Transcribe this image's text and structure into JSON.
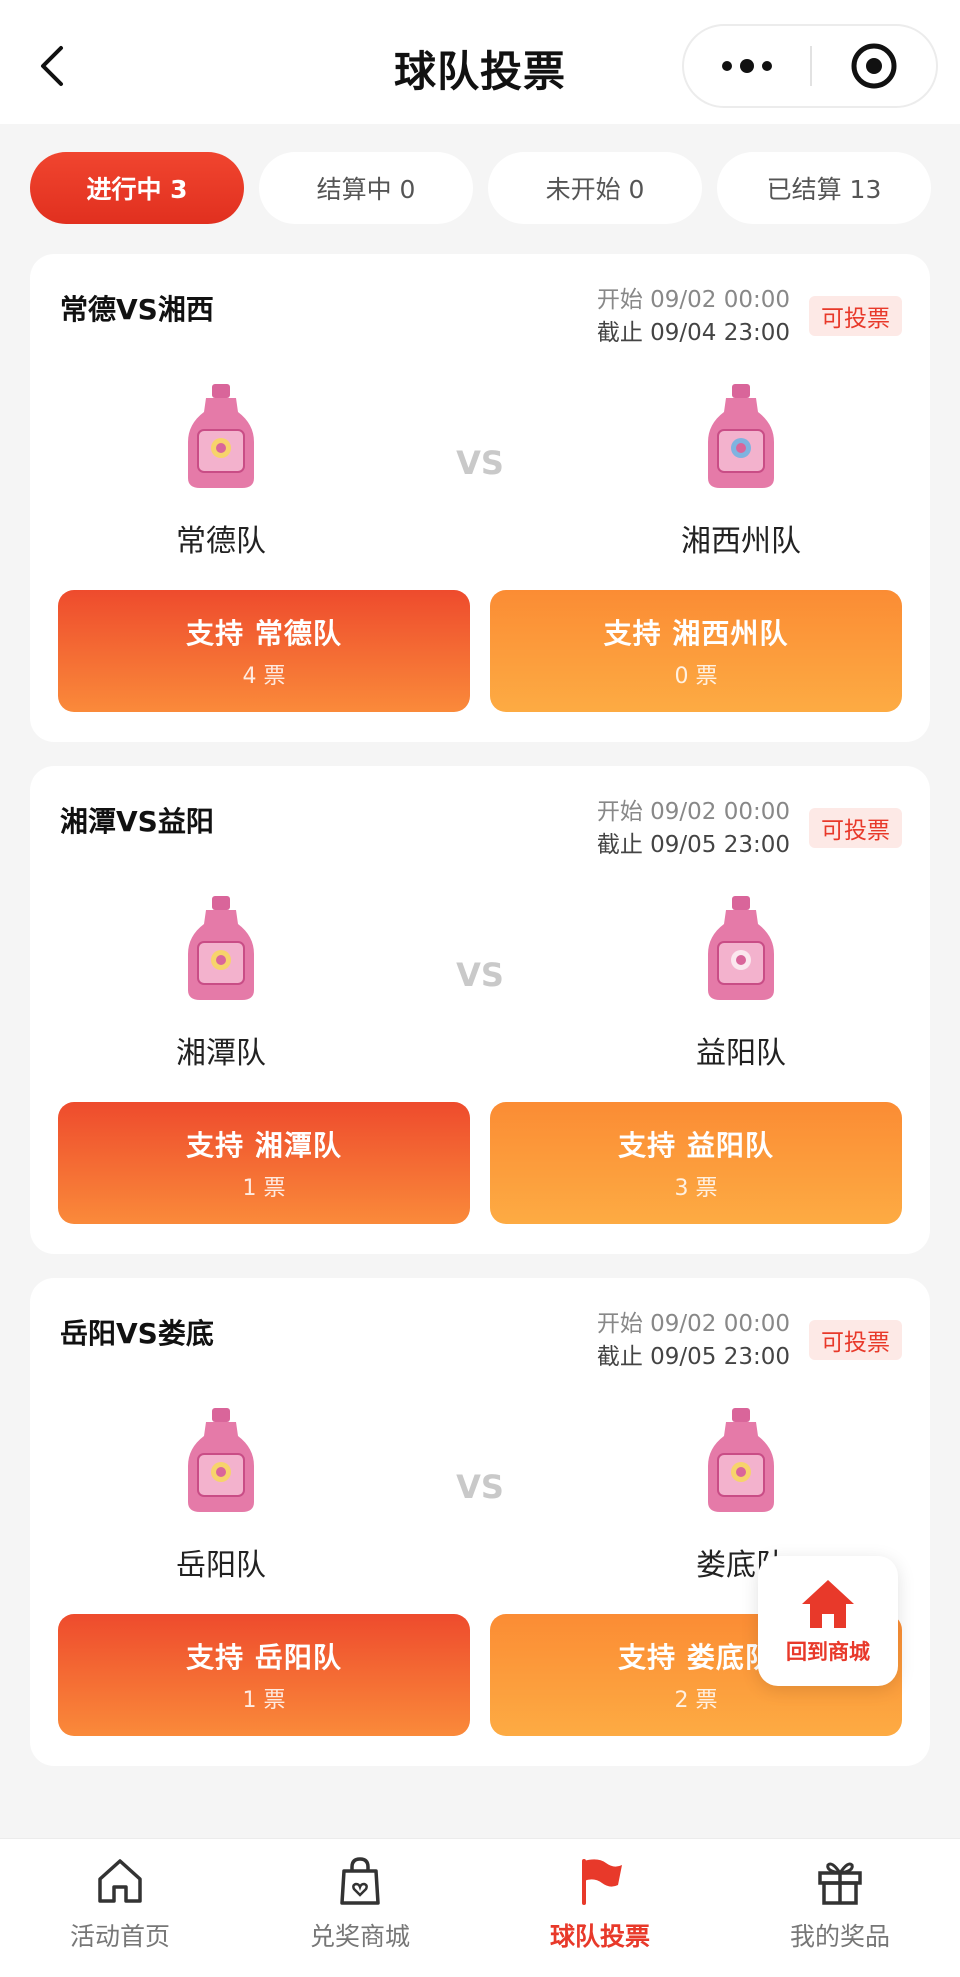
{
  "header": {
    "title": "球队投票"
  },
  "tabs": [
    {
      "label": "进行中 3"
    },
    {
      "label": "结算中 0"
    },
    {
      "label": "未开始 0"
    },
    {
      "label": "已结算 13"
    }
  ],
  "matches": [
    {
      "title": "常德VS湘西",
      "start": "开始 09/02 00:00",
      "end": "截止 09/04 23:00",
      "status": "可投票",
      "vs": "VS",
      "home": {
        "name": "常德队",
        "button": "支持 常德队",
        "votes": "4 票"
      },
      "away": {
        "name": "湘西州队",
        "button": "支持 湘西州队",
        "votes": "0 票"
      }
    },
    {
      "title": "湘潭VS益阳",
      "start": "开始 09/02 00:00",
      "end": "截止 09/05 23:00",
      "status": "可投票",
      "vs": "VS",
      "home": {
        "name": "湘潭队",
        "button": "支持 湘潭队",
        "votes": "1 票"
      },
      "away": {
        "name": "益阳队",
        "button": "支持 益阳队",
        "votes": "3 票"
      }
    },
    {
      "title": "岳阳VS娄底",
      "start": "开始 09/02 00:00",
      "end": "截止 09/05 23:00",
      "status": "可投票",
      "vs": "VS",
      "home": {
        "name": "岳阳队",
        "button": "支持 岳阳队",
        "votes": "1 票"
      },
      "away": {
        "name": "娄底队",
        "button": "支持 娄底队",
        "votes": "2 票"
      }
    }
  ],
  "float_button": {
    "label": "回到商城",
    "icon": "home-icon"
  },
  "nav": [
    {
      "label": "活动首页",
      "icon": "house-icon"
    },
    {
      "label": "兑奖商城",
      "icon": "shopping-bag-icon"
    },
    {
      "label": "球队投票",
      "icon": "flag-icon"
    },
    {
      "label": "我的奖品",
      "icon": "gift-icon"
    }
  ],
  "colors": {
    "accent": "#e8392a",
    "vote_left": "#ee4b2d",
    "vote_right": "#fb8c34",
    "bottle": "#e57aa8"
  }
}
